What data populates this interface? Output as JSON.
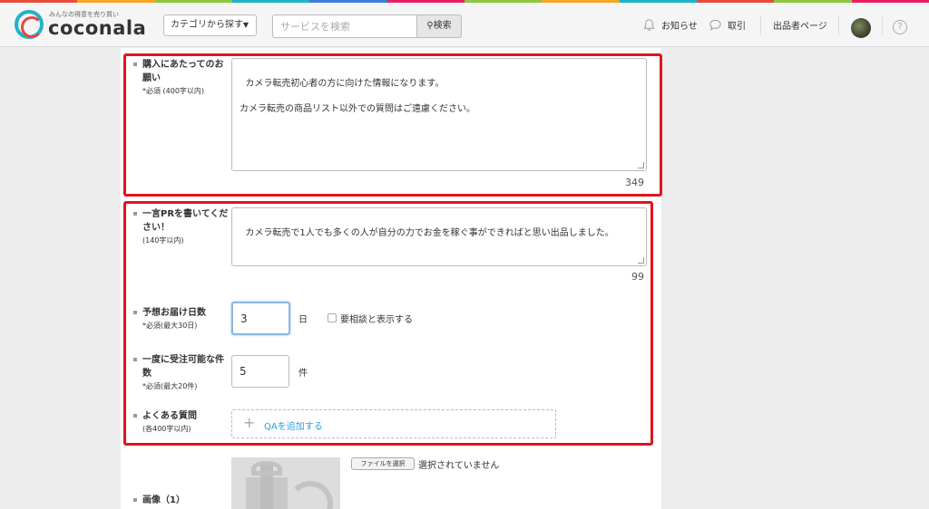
{
  "brand": {
    "tagline": "みんなの得意を売り買い",
    "name": "coconala",
    "stripe_colors": [
      "#e94b3c",
      "#f5a623",
      "#8cc63f",
      "#1fb3c9",
      "#3b7dd8",
      "#e91e63",
      "#8cc63f",
      "#f5a623",
      "#1fb3c9",
      "#e94b3c",
      "#8cc63f",
      "#e91e63"
    ]
  },
  "header": {
    "category_label": "カテゴリから探す",
    "search_placeholder": "サービスを検索",
    "search_button": "検索",
    "nav": {
      "notifications": "お知らせ",
      "transactions": "取引",
      "seller_page": "出品者ページ",
      "help": "?"
    }
  },
  "form": {
    "notes": {
      "label": "購入にあたってのお願い",
      "sub": "*必須 (400字以内)",
      "value": "カメラ転売初心者の方に向けた情報になります。\n\nカメラ転売の商品リスト以外での質問はご遠慮ください。",
      "count": "349"
    },
    "pr": {
      "label": "一言PRを書いてください！",
      "sub": "(140字以内)",
      "value": "カメラ転売で1人でも多くの人が自分の力でお金を稼ぐ事ができればと思い出品しました。",
      "count": "99"
    },
    "delivery": {
      "label": "予想お届け日数",
      "sub": "*必須(最大30日)",
      "value": "3",
      "unit": "日",
      "consult_label": "要相談と表示する"
    },
    "capacity": {
      "label": "一度に受注可能な件数",
      "sub": "*必須(最大20件)",
      "value": "5",
      "unit": "件"
    },
    "faq": {
      "label": "よくある質問",
      "sub": "(各400字以内)",
      "add_label": "QAを追加する"
    },
    "image": {
      "label": "画像（1）",
      "file_button": "ファイルを選択",
      "file_status": "選択されていません"
    }
  }
}
